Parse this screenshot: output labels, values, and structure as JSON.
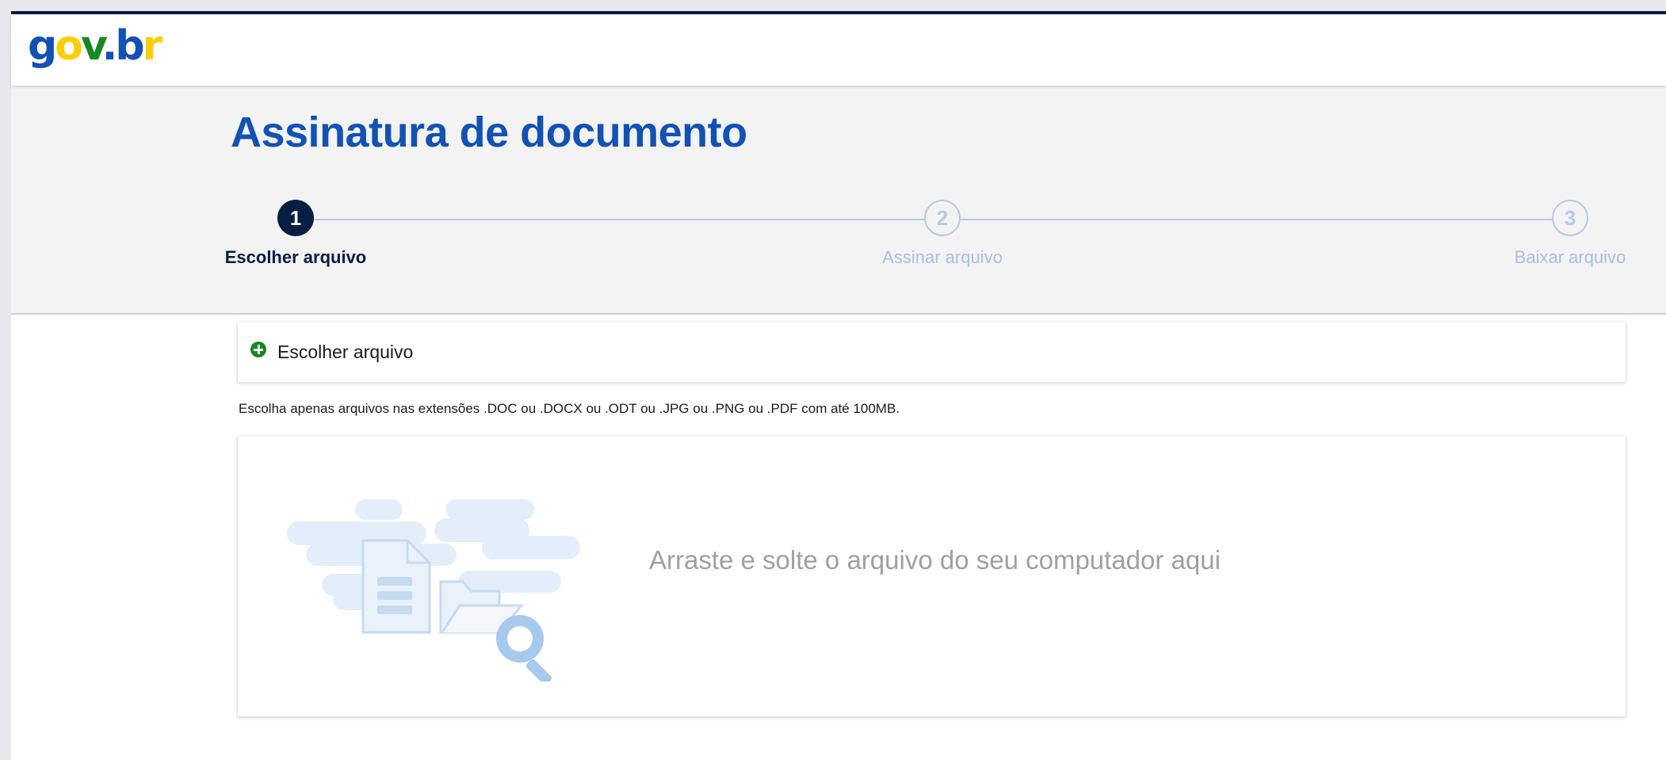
{
  "header": {
    "logo": {
      "g": "g",
      "o": "o",
      "v": "v",
      "dot": ".",
      "b": "b",
      "r": "r"
    }
  },
  "page": {
    "title": "Assinatura de documento"
  },
  "steps": [
    {
      "number": "1",
      "label": "Escolher arquivo",
      "state": "active"
    },
    {
      "number": "2",
      "label": "Assinar arquivo",
      "state": "inactive"
    },
    {
      "number": "3",
      "label": "Baixar arquivo",
      "state": "inactive"
    }
  ],
  "upload": {
    "choose_label": "Escolher arquivo",
    "hint": "Escolha apenas arquivos nas extensões .DOC ou .DOCX ou .ODT ou .JPG ou .PNG ou .PDF com até 100MB.",
    "drop_text": "Arraste e solte o arquivo do seu computador aqui",
    "illustration_icon": "file-folder-search-icon"
  },
  "colors": {
    "primary_blue": "#1351b4",
    "dark_navy": "#071d41",
    "success_green": "#168821",
    "gov_yellow": "#ffcd07",
    "step_inactive": "#b5c9ea"
  }
}
